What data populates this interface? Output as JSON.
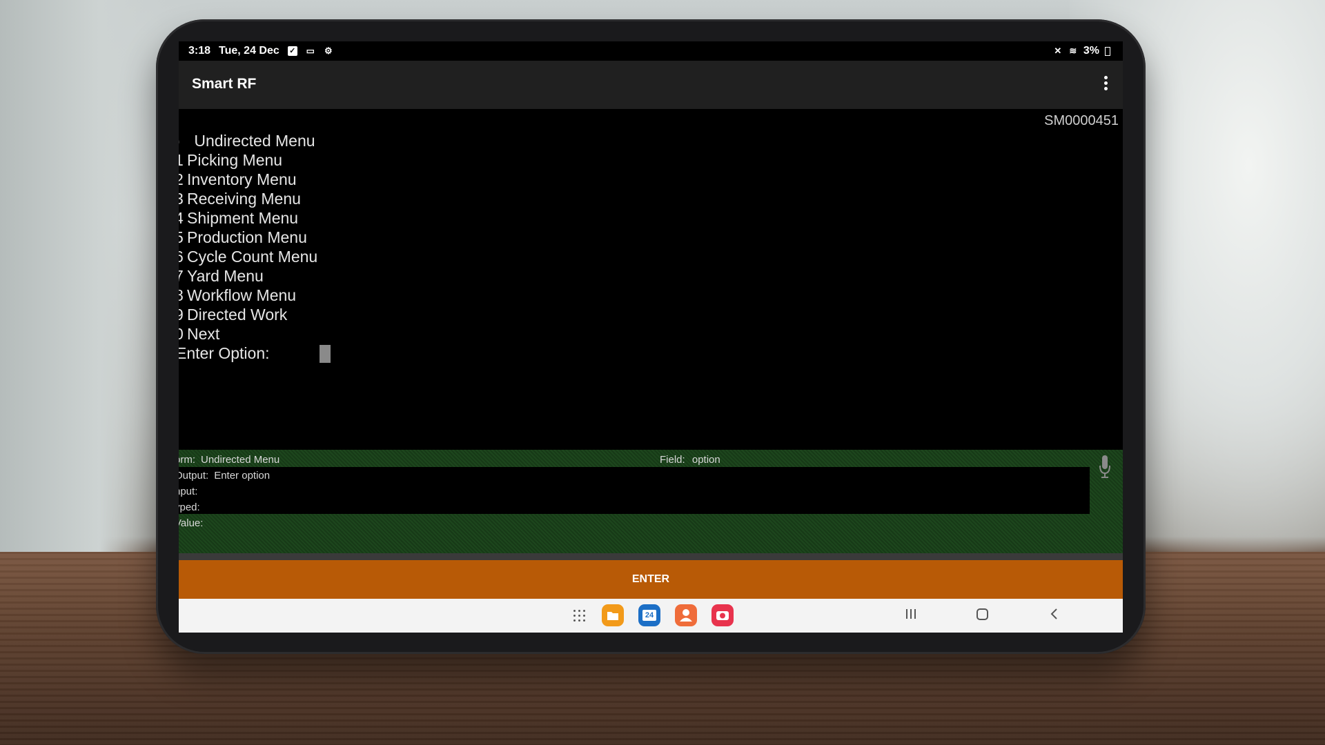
{
  "status_bar": {
    "time": "3:18",
    "date": "Tue, 24 Dec",
    "battery": "3%"
  },
  "app_bar": {
    "title": "Smart RF"
  },
  "terminal": {
    "device_id": "SM0000451",
    "menu_items": [
      {
        "num": ")",
        "label": "Undirected Menu"
      },
      {
        "num": "1",
        "label": "Picking Menu"
      },
      {
        "num": "2",
        "label": "Inventory Menu"
      },
      {
        "num": "3",
        "label": "Receiving Menu"
      },
      {
        "num": "4",
        "label": "Shipment Menu"
      },
      {
        "num": "5",
        "label": "Production Menu"
      },
      {
        "num": "6",
        "label": "Cycle Count Menu"
      },
      {
        "num": "7",
        "label": "Yard Menu"
      },
      {
        "num": "8",
        "label": "Workflow Menu"
      },
      {
        "num": "9",
        "label": "Directed Work"
      },
      {
        "num": "0",
        "label": "Next"
      }
    ],
    "prompt": "Enter Option:"
  },
  "info_panel": {
    "form_label": "orm:",
    "form_value": "Undirected Menu",
    "field_label": "Field:",
    "field_value": "option",
    "output_label": "Output:",
    "output_value": "Enter option",
    "input_label": "nput:",
    "typed_label": "yped:",
    "value_label": "Value:"
  },
  "enter_button": {
    "label": "ENTER"
  },
  "nav_bar": {
    "calendar_day": "24"
  },
  "colors": {
    "enter_button": "#b85a06",
    "info_panel": "#1a401a",
    "app_bar": "#202020"
  }
}
